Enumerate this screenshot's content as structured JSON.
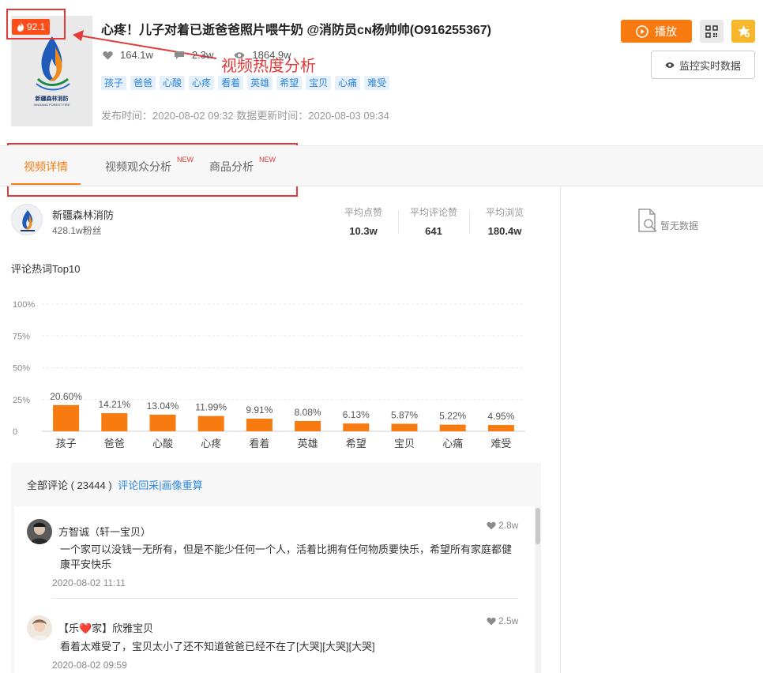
{
  "video": {
    "heat": "92.1",
    "title": "心疼！儿子对着已逝爸爸照片喂牛奶 @消防员ᴄɴ杨帅帅(O916255367)",
    "likes": "164.1w",
    "comments": "2.3w",
    "views": "1864.9w",
    "tags": [
      "孩子",
      "爸爸",
      "心酸",
      "心疼",
      "看着",
      "英雄",
      "希望",
      "宝贝",
      "心痛",
      "难受"
    ],
    "dates": "发布时间：2020-08-02 09:32 数据更新时间：2020-08-03 09:34",
    "thumb_text": "新疆森林消防",
    "thumb_sub": "XINJIANG FOREST FIRE"
  },
  "annotation": "视频热度分析",
  "actions": {
    "play": "播放",
    "monitor": "监控实时数据"
  },
  "tabs": [
    {
      "label": "视频详情",
      "badge": ""
    },
    {
      "label": "视频观众分析",
      "badge": "NEW"
    },
    {
      "label": "商品分析",
      "badge": "NEW"
    }
  ],
  "author": {
    "name": "新疆森林消防",
    "fans": "428.1w粉丝",
    "avg": [
      {
        "label": "平均点赞",
        "value": "10.3w"
      },
      {
        "label": "平均评论赞",
        "value": "641"
      },
      {
        "label": "平均浏览",
        "value": "180.4w"
      }
    ]
  },
  "right_panel": {
    "empty": "暂无数据"
  },
  "chart_title": "评论热词Top10",
  "chart_data": {
    "type": "bar",
    "categories": [
      "孩子",
      "爸爸",
      "心酸",
      "心疼",
      "看着",
      "英雄",
      "希望",
      "宝贝",
      "心痛",
      "难受"
    ],
    "values": [
      20.6,
      14.21,
      13.04,
      11.99,
      9.91,
      8.08,
      6.13,
      5.87,
      5.22,
      4.95
    ],
    "value_labels": [
      "20.60%",
      "14.21%",
      "13.04%",
      "11.99%",
      "9.91%",
      "8.08%",
      "6.13%",
      "5.87%",
      "5.22%",
      "4.95%"
    ],
    "yticks": [
      "0",
      "25%",
      "50%",
      "75%",
      "100%"
    ],
    "ylim": [
      0,
      100
    ],
    "grid": true,
    "color": "#f77b10"
  },
  "comments_section": {
    "header": "全部评论 ( 23444 )",
    "link": "评论回采|画像重算",
    "items": [
      {
        "user": "方智诚（轩一宝贝）",
        "likes": "2.8w",
        "text": "一个家可以没钱一无所有，但是不能少任何一个人，活着比拥有任何物质要快乐，希望所有家庭都健康平安快乐",
        "date": "2020-08-02 11:11"
      },
      {
        "user": "【乐❤️家】欣雅宝贝",
        "likes": "2.5w",
        "text": "看着太难受了，宝贝太小了还不知道爸爸已经不在了[大哭][大哭][大哭]",
        "date": "2020-08-02 09:59"
      }
    ]
  }
}
